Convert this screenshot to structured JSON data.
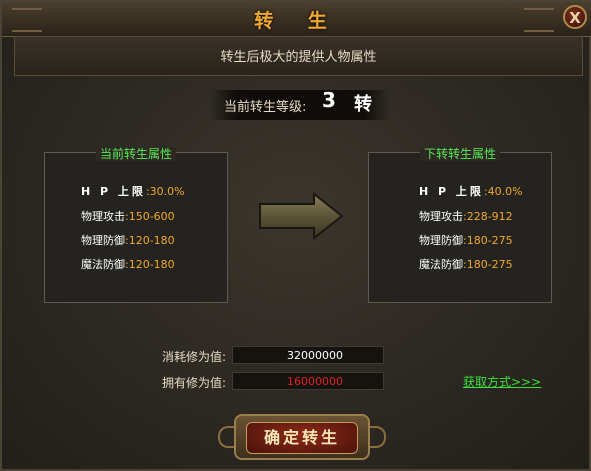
{
  "window": {
    "title": "转 生",
    "close_glyph": "X",
    "subtitle": "转生后极大的提供人物属性"
  },
  "level": {
    "label": "当前转生等级:",
    "value": "3",
    "unit": "转"
  },
  "current_panel": {
    "title": "当前转生属性",
    "rows": [
      {
        "label": "H P 上限",
        "value": ":30.0%"
      },
      {
        "label": "物理攻击",
        "value": ":150-600"
      },
      {
        "label": "物理防御",
        "value": ":120-180"
      },
      {
        "label": "魔法防御",
        "value": ":120-180"
      }
    ]
  },
  "next_panel": {
    "title": "下转转生属性",
    "rows": [
      {
        "label": "H P 上限",
        "value": ":40.0%"
      },
      {
        "label": "物理攻击",
        "value": ":228-912"
      },
      {
        "label": "物理防御",
        "value": ":180-275"
      },
      {
        "label": "魔法防御",
        "value": ":180-275"
      }
    ]
  },
  "cost": {
    "consume_label": "消耗修为值:",
    "consume_value": "32000000",
    "own_label": "拥有修为值:",
    "own_value": "16000000",
    "obtain_link": "获取方式>>>"
  },
  "confirm_button": "确定转生",
  "colors": {
    "title_gold": "#f0a830",
    "panel_title_green": "#58e858",
    "value_orange": "#f0a830",
    "insufficient_red": "#e02020",
    "link_green": "#39e039"
  },
  "icons": {
    "close": "close-icon",
    "arrow": "right-arrow-icon"
  }
}
